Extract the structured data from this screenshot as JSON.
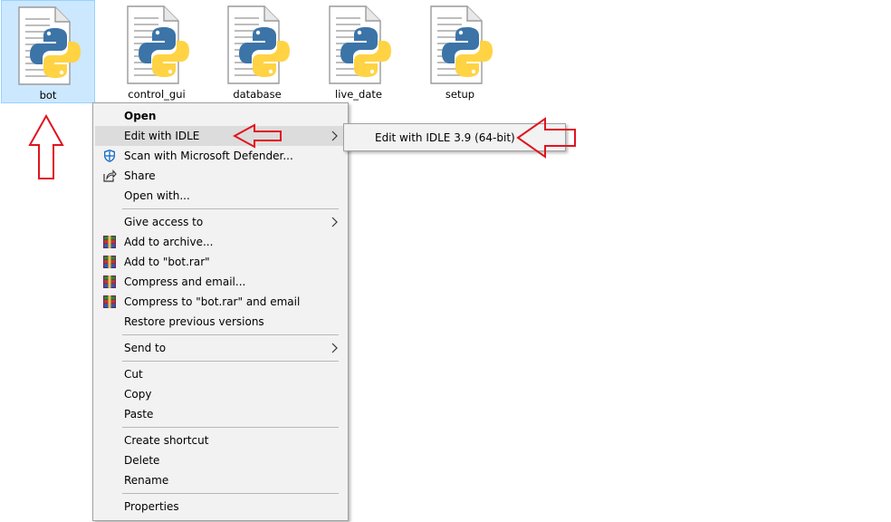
{
  "files": [
    {
      "name": "bot",
      "selected": true
    },
    {
      "name": "control_gui",
      "selected": false
    },
    {
      "name": "database",
      "selected": false
    },
    {
      "name": "live_date",
      "selected": false
    },
    {
      "name": "setup",
      "selected": false
    }
  ],
  "context_menu": {
    "items": [
      {
        "label": "Open",
        "bold": true
      },
      {
        "label": "Edit with IDLE",
        "submenu": true,
        "highlighted": true
      },
      {
        "label": "Scan with Microsoft Defender...",
        "icon": "defender-shield-icon"
      },
      {
        "label": "Share",
        "icon": "share-icon"
      },
      {
        "label": "Open with..."
      },
      {
        "label": "Give access to",
        "submenu": true
      },
      {
        "label": "Add to archive...",
        "icon": "winrar-icon"
      },
      {
        "label": "Add to \"bot.rar\"",
        "icon": "winrar-icon"
      },
      {
        "label": "Compress and email...",
        "icon": "winrar-icon"
      },
      {
        "label": "Compress to \"bot.rar\" and email",
        "icon": "winrar-icon"
      },
      {
        "label": "Restore previous versions"
      },
      {
        "label": "Send to",
        "submenu": true
      },
      {
        "label": "Cut"
      },
      {
        "label": "Copy"
      },
      {
        "label": "Paste"
      },
      {
        "label": "Create shortcut"
      },
      {
        "label": "Delete"
      },
      {
        "label": "Rename"
      },
      {
        "label": "Properties"
      }
    ]
  },
  "submenu": {
    "items": [
      {
        "label": "Edit with IDLE 3.9 (64-bit)"
      }
    ]
  },
  "colors": {
    "selection_bg": "#cce8ff",
    "menu_bg": "#f2f2f2",
    "highlight_bg": "#dcdcdc",
    "annotation_arrow": "#e0141e",
    "python_blue": "#3c74a8",
    "python_yellow": "#ffd343"
  }
}
